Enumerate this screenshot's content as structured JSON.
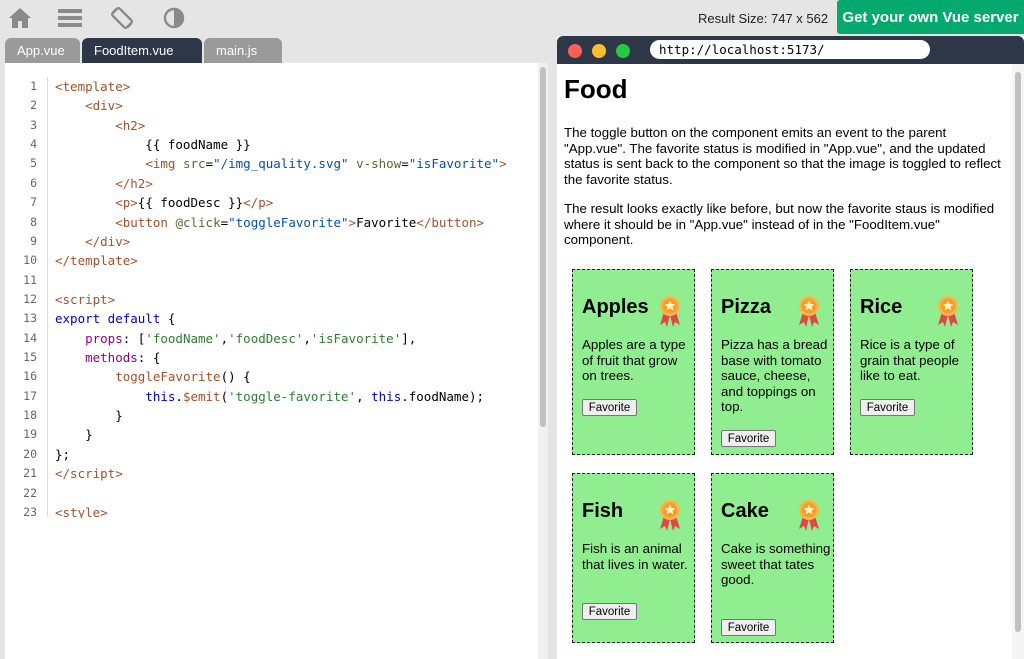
{
  "topbar": {
    "icons": [
      "home-icon",
      "menu-icon",
      "rotate-icon",
      "contrast-icon"
    ],
    "result_size": "Result Size: 747 x 562",
    "get_server_label": "Get your own Vue server"
  },
  "editor": {
    "tabs": [
      {
        "label": "App.vue",
        "active": false
      },
      {
        "label": "FoodItem.vue",
        "active": true
      },
      {
        "label": "main.js",
        "active": false
      }
    ],
    "line_numbers": [
      "1",
      "2",
      "3",
      "4",
      "5",
      "6",
      "7",
      "8",
      "9",
      "10",
      "11",
      "12",
      "13",
      "14",
      "15",
      "16",
      "17",
      "18",
      "19",
      "20",
      "21",
      "22",
      "23"
    ]
  },
  "browser": {
    "url": "http://localhost:5173/",
    "dot_colors": [
      "#ff5f56",
      "#ffbd2e",
      "#27c93f"
    ],
    "page": {
      "title": "Food",
      "paragraph1": "The toggle button on the component emits an event to the parent \"App.vue\". The favorite status is modified in \"App.vue\", and the updated status is sent back to the component so that the image is toggled to reflect the favorite status.",
      "paragraph2": "The result looks exactly like before, but now the favorite staus is modified where it should be in \"App.vue\" instead of in the \"FoodItem.vue\" component.",
      "cards": [
        {
          "name": "Apples",
          "desc": "Apples are a type of fruit that grow on trees.",
          "button": "Favorite",
          "favorite": true
        },
        {
          "name": "Pizza",
          "desc": "Pizza has a bread base with tomato sauce, cheese, and toppings on top.",
          "button": "Favorite",
          "favorite": true
        },
        {
          "name": "Rice",
          "desc": "Rice is a type of grain that people like to eat.",
          "button": "Favorite",
          "favorite": true
        },
        {
          "name": "Fish",
          "desc": "Fish is an animal that lives in water.",
          "button": "Favorite",
          "favorite": true
        },
        {
          "name": "Cake",
          "desc": "Cake is something sweet that tates good.",
          "button": "Favorite",
          "favorite": true
        }
      ]
    }
  },
  "colors": {
    "accent": "#04aa6d",
    "card_bg": "#90ee90",
    "tab_active": "#2d3748"
  }
}
